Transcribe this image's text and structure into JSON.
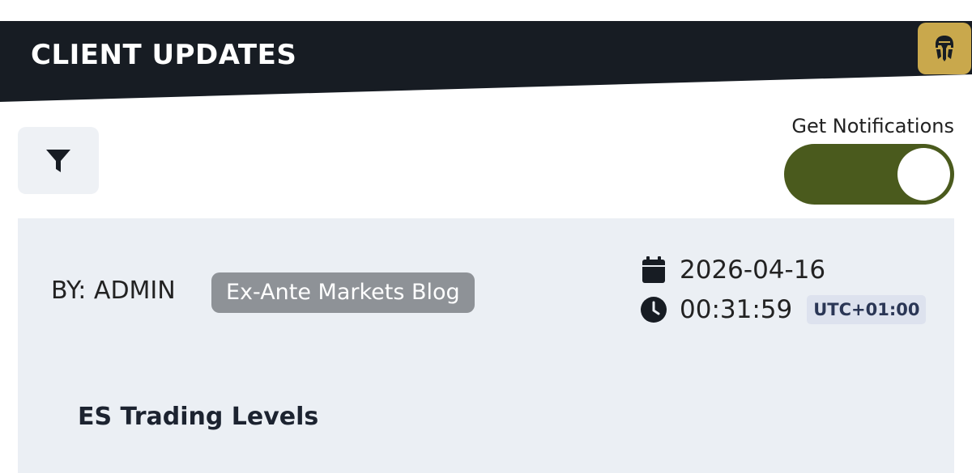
{
  "header": {
    "title": "CLIENT UPDATES",
    "logo_icon": "mandalorian-skull-icon",
    "background_color": "#171c23",
    "logo_color": "#c9a84c"
  },
  "toolbar": {
    "filter_icon": "filter-icon"
  },
  "notifications": {
    "label": "Get Notifications",
    "enabled": true,
    "toggle_color": "#4a5a1d"
  },
  "post": {
    "author": "BY: ADMIN",
    "category": "Ex-Ante Markets Blog",
    "date": "2026-04-16",
    "time": "00:31:59",
    "timezone": "UTC+01:00",
    "title": "ES Trading Levels",
    "date_icon": "calendar-icon",
    "time_icon": "clock-icon"
  }
}
